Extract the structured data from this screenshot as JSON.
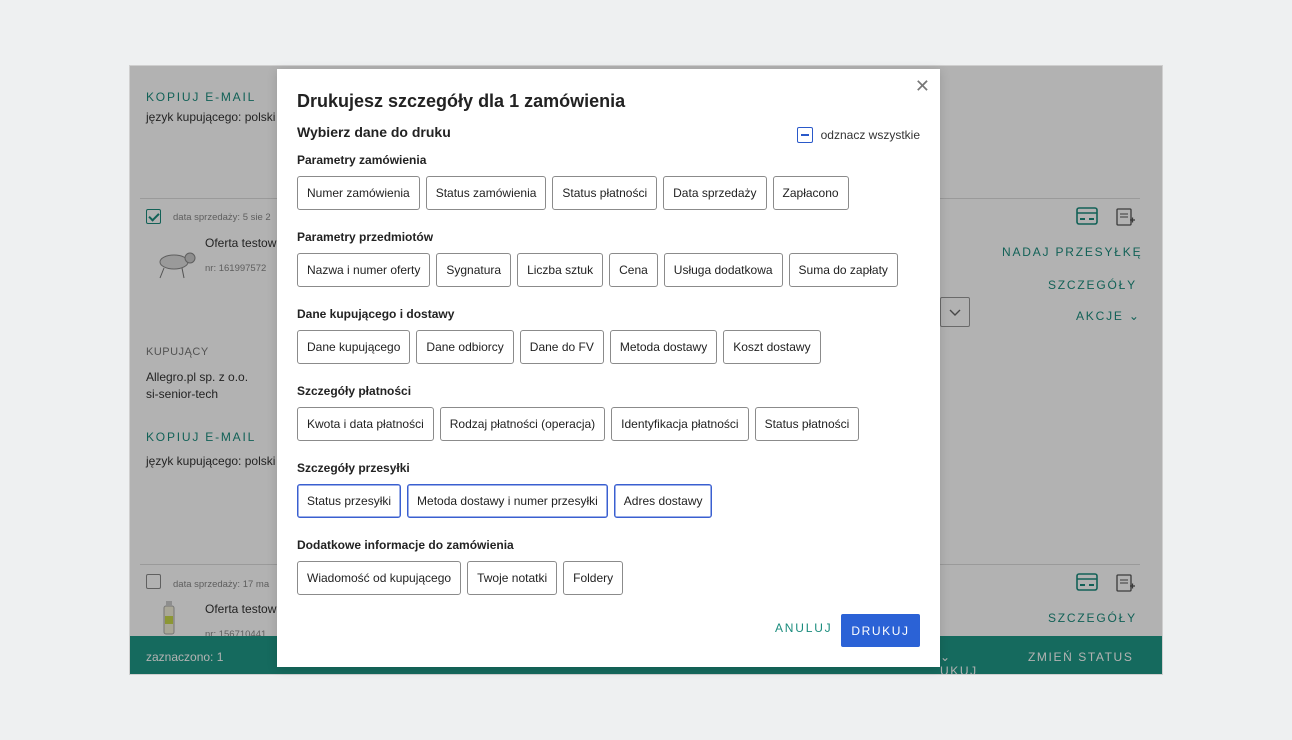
{
  "background": {
    "copy_email_1": "KOPIUJ E-MAIL",
    "buyer_lang_1": "język kupującego: polski",
    "sale_date_1": "data sprzedaży:  5 sie 2",
    "offer_1": "Oferta testow",
    "nr_1": "nr: 161997572",
    "ship_link": "NADAJ PRZESYŁKĘ",
    "details_link_1": "SZCZEGÓŁY",
    "actions_link": "AKCJE",
    "buyer_header": "KUPUJĄCY",
    "buyer_name": "Allegro.pl sp. z o.o.",
    "buyer_login": "si-senior-tech",
    "copy_email_2": "KOPIUJ E-MAIL",
    "buyer_lang_2": "język kupującego: polski",
    "sale_date_2": "data sprzedaży:  17 ma",
    "offer_2": "Oferta testow",
    "nr_2": "nr: 156710441",
    "details_link_2": "SZCZEGÓŁY",
    "selected_count": "zaznaczono: 1",
    "print_menu": "UKUJ",
    "change_status": "ZMIEŃ STATUS"
  },
  "modal": {
    "title": "Drukujesz szczegóły dla 1 zamówienia",
    "subtitle": "Wybierz dane do druku",
    "deselect_all": "odznacz wszystkie",
    "sections": [
      {
        "title": "Parametry zamówienia",
        "chips": [
          "Numer zamówienia",
          "Status zamówienia",
          "Status płatności",
          "Data sprzedaży",
          "Zapłacono"
        ]
      },
      {
        "title": "Parametry przedmiotów",
        "chips": [
          "Nazwa i numer oferty",
          "Sygnatura",
          "Liczba sztuk",
          "Cena",
          "Usługa dodatkowa",
          "Suma do zapłaty"
        ]
      },
      {
        "title": "Dane kupującego i dostawy",
        "chips": [
          "Dane kupującego",
          "Dane odbiorcy",
          "Dane do FV",
          "Metoda dostawy",
          "Koszt dostawy"
        ]
      },
      {
        "title": "Szczegóły płatności",
        "chips": [
          "Kwota i data płatności",
          "Rodzaj płatności (operacja)",
          "Identyfikacja płatności",
          "Status płatności"
        ]
      },
      {
        "title": "Szczegóły przesyłki",
        "chips": [
          "Status przesyłki",
          "Metoda dostawy i numer przesyłki",
          "Adres dostawy"
        ]
      },
      {
        "title": "Dodatkowe informacje do zamówienia",
        "chips": [
          "Wiadomość od kupującego",
          "Twoje notatki",
          "Foldery"
        ]
      }
    ],
    "cancel_label": "ANULUJ",
    "print_label": "DRUKUJ"
  }
}
